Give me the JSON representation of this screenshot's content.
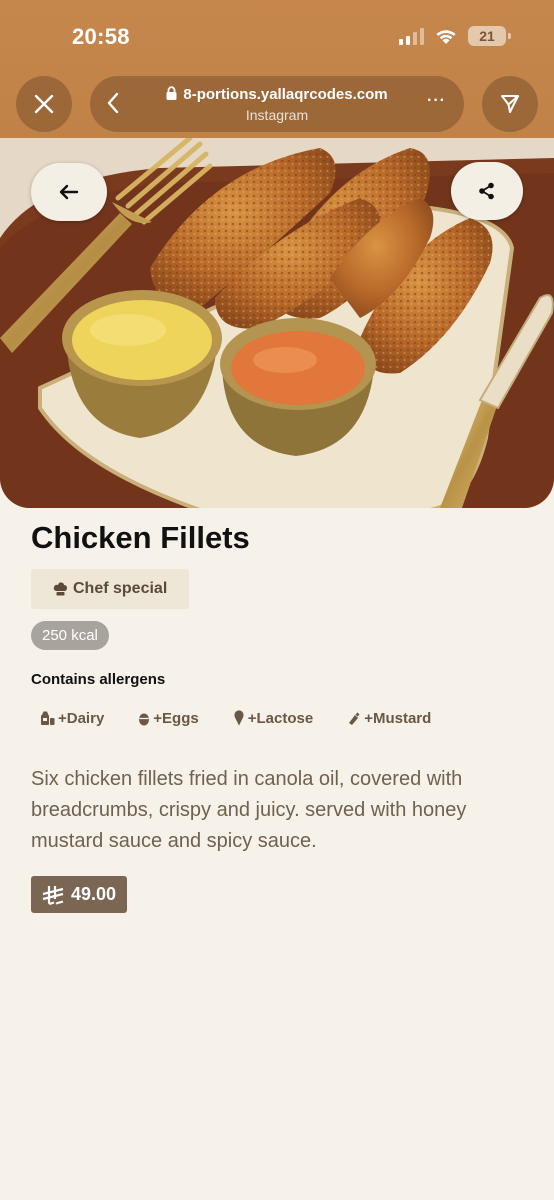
{
  "status_bar": {
    "time": "20:58",
    "battery": "21"
  },
  "browser": {
    "url": "8-portions.yallaqrcodes.com",
    "source": "Instagram",
    "more_label": "···",
    "icons": [
      "close-icon",
      "back-chevron-icon",
      "lock-icon",
      "more-icon",
      "send-icon"
    ]
  },
  "hero": {
    "icons": [
      "arrow-left-icon",
      "share-icon"
    ]
  },
  "item": {
    "title": "Chicken Fillets",
    "tag": "Chef special",
    "kcal": "250 kcal",
    "allergens_title": "Contains allergens",
    "allergens": [
      {
        "label": "+Dairy",
        "icon": "milk-icon"
      },
      {
        "label": "+Eggs",
        "icon": "egg-icon"
      },
      {
        "label": "+Lactose",
        "icon": "ice-cream-icon"
      },
      {
        "label": "+Mustard",
        "icon": "mustard-icon"
      }
    ],
    "description": "Six chicken fillets fried in canola oil, covered with breadcrumbs, crispy and juicy. served with honey mustard sauce and spicy sauce.",
    "price": "49.00",
    "currency_icon": "riyal-icon"
  },
  "colors": {
    "chrome": "#c08247",
    "background": "#f6f2e9",
    "price_badge": "#7b6553",
    "tag_bg": "#eee7d8"
  }
}
